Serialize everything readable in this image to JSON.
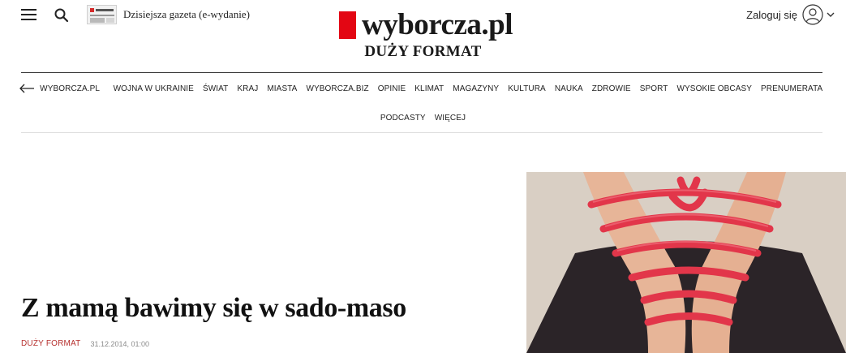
{
  "header": {
    "epaper_label": "Dzisiejsza gazeta (e-wydanie)",
    "logo_text": "wyborcza.pl",
    "section_title": "DUŻY FORMAT",
    "login_label": "Zaloguj się",
    "icons": [
      "menu-icon",
      "search-icon",
      "avatar-icon",
      "chevron-down-icon"
    ],
    "brand_color": "#e30613"
  },
  "nav": {
    "back_label": "WYBORCZA.PL",
    "row1": [
      "WOJNA W UKRAINIE",
      "ŚWIAT",
      "KRAJ",
      "MIASTA",
      "WYBORCZA.BIZ",
      "OPINIE",
      "KLIMAT",
      "MAGAZYNY",
      "KULTURA",
      "NAUKA",
      "ZDROWIE",
      "SPORT",
      "WYSOKIE OBCASY",
      "PRENUMERATA"
    ],
    "row2": [
      "PODCASTY",
      "WIĘCEJ"
    ]
  },
  "article": {
    "headline": "Z mamą bawimy się w sado-maso",
    "section": "DUŻY FORMAT",
    "date": "31.12.2014, 01:00",
    "section_color": "#b6312f"
  }
}
